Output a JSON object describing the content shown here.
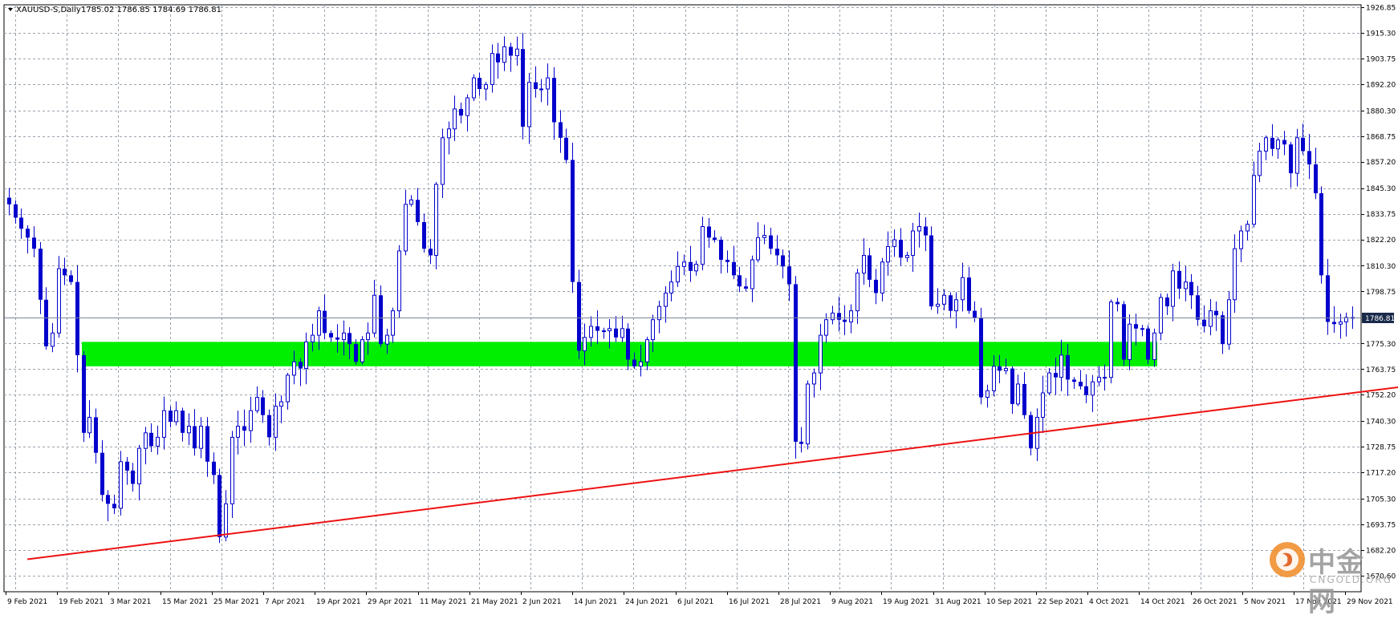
{
  "header": {
    "title": "XAUUSD-S,Daily",
    "ohlc": "1785.02 1786.85 1784.69 1786.81"
  },
  "price_tag": "1786.81",
  "watermark": {
    "text": "中金网",
    "sub": "CNGOLD.ORG"
  },
  "colors": {
    "candle": "#0000cc",
    "zone": "#00ee00",
    "trendline": "#ee1111",
    "grid": "#9aa3ad",
    "price_line": "#7a869a"
  },
  "chart_data": {
    "type": "candlestick",
    "symbol": "XAUUSD-S",
    "timeframe": "Daily",
    "ylim": [
      1670.6,
      1926.85
    ],
    "y_ticks": [
      "1926.85",
      "1915.30",
      "1903.75",
      "1892.20",
      "1880.30",
      "1868.75",
      "1857.20",
      "1845.30",
      "1833.75",
      "1822.20",
      "1810.30",
      "1798.75",
      "1786.81",
      "1775.30",
      "1763.75",
      "1752.20",
      "1740.30",
      "1728.75",
      "1717.20",
      "1705.30",
      "1693.75",
      "1682.20",
      "1670.60"
    ],
    "x_ticks": [
      "9 Feb 2021",
      "19 Feb 2021",
      "3 Mar 2021",
      "15 Mar 2021",
      "25 Mar 2021",
      "7 Apr 2021",
      "19 Apr 2021",
      "29 Apr 2021",
      "11 May 2021",
      "21 May 2021",
      "2 Jun 2021",
      "14 Jun 2021",
      "24 Jun 2021",
      "6 Jul 2021",
      "16 Jul 2021",
      "28 Jul 2021",
      "9 Aug 2021",
      "19 Aug 2021",
      "31 Aug 2021",
      "10 Sep 2021",
      "22 Sep 2021",
      "4 Oct 2021",
      "14 Oct 2021",
      "26 Oct 2021",
      "5 Nov 2021",
      "17 Nov 2021",
      "29 Nov 2021"
    ],
    "current_price": 1786.81,
    "support_zone": {
      "from": 1765,
      "to": 1776
    },
    "trendline": {
      "from": [
        3,
        1678
      ],
      "to": [
        258,
        1768
      ]
    },
    "closes": [
      1838,
      1832,
      1827,
      1823,
      1818,
      1795,
      1774,
      1780,
      1809,
      1806,
      1803,
      1770,
      1735,
      1742,
      1726,
      1707,
      1703,
      1701,
      1722,
      1718,
      1712,
      1728,
      1735,
      1729,
      1733,
      1745,
      1740,
      1745,
      1735,
      1738,
      1728,
      1738,
      1722,
      1716,
      1688,
      1703,
      1733,
      1738,
      1736,
      1745,
      1751,
      1743,
      1733,
      1747,
      1749,
      1761,
      1767,
      1764,
      1776,
      1779,
      1790,
      1780,
      1778,
      1777,
      1780,
      1775,
      1767,
      1777,
      1780,
      1797,
      1775,
      1779,
      1790,
      1817,
      1838,
      1840,
      1830,
      1818,
      1815,
      1847,
      1868,
      1872,
      1881,
      1878,
      1886,
      1895,
      1890,
      1892,
      1906,
      1902,
      1909,
      1905,
      1908,
      1873,
      1893,
      1890,
      1890,
      1895,
      1875,
      1868,
      1858,
      1803,
      1772,
      1778,
      1783,
      1781,
      1781,
      1782,
      1778,
      1782,
      1768,
      1765,
      1767,
      1777,
      1786,
      1792,
      1798,
      1803,
      1810,
      1812,
      1808,
      1811,
      1828,
      1823,
      1822,
      1813,
      1812,
      1806,
      1801,
      1800,
      1813,
      1823,
      1824,
      1818,
      1815,
      1810,
      1802,
      1731,
      1730,
      1757,
      1762,
      1779,
      1786,
      1789,
      1786,
      1785,
      1790,
      1807,
      1815,
      1804,
      1798,
      1812,
      1819,
      1822,
      1814,
      1815,
      1826,
      1828,
      1824,
      1792,
      1793,
      1797,
      1790,
      1795,
      1805,
      1790,
      1787,
      1751,
      1754,
      1765,
      1763,
      1764,
      1748,
      1757,
      1743,
      1728,
      1742,
      1753,
      1762,
      1760,
      1770,
      1759,
      1758,
      1756,
      1752,
      1758,
      1760,
      1760,
      1794,
      1793,
      1768,
      1784,
      1782,
      1782,
      1768,
      1780,
      1796,
      1792,
      1808,
      1800,
      1803,
      1797,
      1786,
      1783,
      1790,
      1788,
      1775,
      1795,
      1818,
      1826,
      1829,
      1851,
      1862,
      1868,
      1863,
      1867,
      1865,
      1852,
      1868,
      1862,
      1856,
      1843,
      1806,
      1785,
      1784,
      1785,
      1787,
      1787
    ]
  }
}
